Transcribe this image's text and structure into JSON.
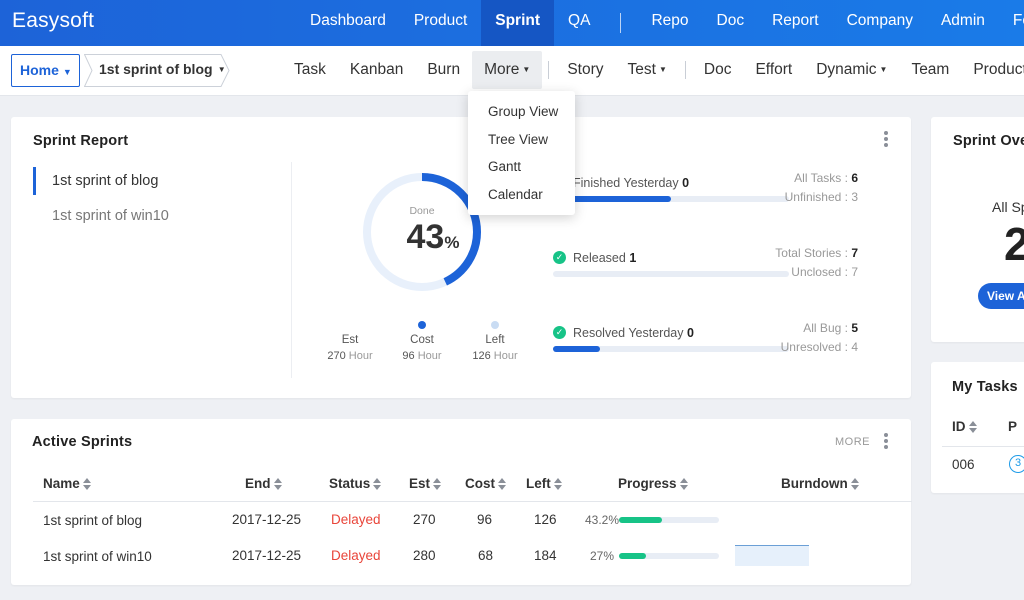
{
  "brand": "Easysoft",
  "top_nav": [
    {
      "label": "Dashboard"
    },
    {
      "label": "Product"
    },
    {
      "label": "Sprint",
      "active": true
    },
    {
      "label": "QA"
    },
    {
      "label": "Repo"
    },
    {
      "label": "Doc"
    },
    {
      "label": "Report"
    },
    {
      "label": "Company"
    },
    {
      "label": "Admin"
    },
    {
      "label": "Fe"
    }
  ],
  "breadcrumb": {
    "home": "Home",
    "sprint": "1st sprint of blog"
  },
  "sub_nav": [
    {
      "label": "Task"
    },
    {
      "label": "Kanban"
    },
    {
      "label": "Burn"
    },
    {
      "label": "More",
      "has_caret": true,
      "open": true
    },
    {
      "label": "Story"
    },
    {
      "label": "Test",
      "has_caret": true
    },
    {
      "label": "Doc"
    },
    {
      "label": "Effort"
    },
    {
      "label": "Dynamic",
      "has_caret": true
    },
    {
      "label": "Team"
    },
    {
      "label": "Product"
    }
  ],
  "more_menu": [
    "Group View",
    "Tree View",
    "Gantt",
    "Calendar"
  ],
  "sprint_report": {
    "title": "Sprint Report",
    "sprints": [
      "1st sprint of blog",
      "1st sprint of win10"
    ],
    "donut": {
      "label": "Done",
      "value": "43",
      "unit": "%",
      "fraction": 0.43
    },
    "stats": [
      {
        "label": "Est",
        "value": "270",
        "unit": "Hour"
      },
      {
        "label": "Cost",
        "value": "96",
        "unit": "Hour"
      },
      {
        "label": "Left",
        "value": "126",
        "unit": "Hour"
      }
    ],
    "rows": [
      {
        "label": "Finished Yesterday",
        "value": "0",
        "fill": 0.5,
        "r1_label": "All Tasks :",
        "r1_value": "6",
        "r2": "Unfinished : 3"
      },
      {
        "label": "Released",
        "value": "1",
        "fill": 0,
        "r1_label": "Total Stories :",
        "r1_value": "7",
        "r2": "Unclosed : 7"
      },
      {
        "label": "Resolved Yesterday",
        "value": "0",
        "fill": 0.2,
        "r1_label": "All Bug :",
        "r1_value": "5",
        "r2": "Unresolved : 4"
      }
    ]
  },
  "active_sprints": {
    "title": "Active Sprints",
    "more": "MORE",
    "columns": [
      "Name",
      "End",
      "Status",
      "Est",
      "Cost",
      "Left",
      "Progress",
      "Burndown"
    ],
    "rows": [
      {
        "name": "1st sprint of blog",
        "end": "2017-12-25",
        "status": "Delayed",
        "est": "270",
        "cost": "96",
        "left": "126",
        "progress": "43.2%",
        "progress_value": 0.432
      },
      {
        "name": "1st sprint of win10",
        "end": "2017-12-25",
        "status": "Delayed",
        "est": "280",
        "cost": "68",
        "left": "184",
        "progress": "27%",
        "progress_value": 0.27
      }
    ]
  },
  "sprint_overview": {
    "title": "Sprint Ove",
    "label": "All Sp",
    "big_number": "2",
    "button": "View A"
  },
  "my_tasks": {
    "title": "My Tasks",
    "col_id": "ID",
    "col_p": "P",
    "row_id": "006",
    "row_p": "3"
  },
  "colors": {
    "primary": "#1d63d8",
    "success": "#17c387",
    "danger": "#e9453a"
  }
}
